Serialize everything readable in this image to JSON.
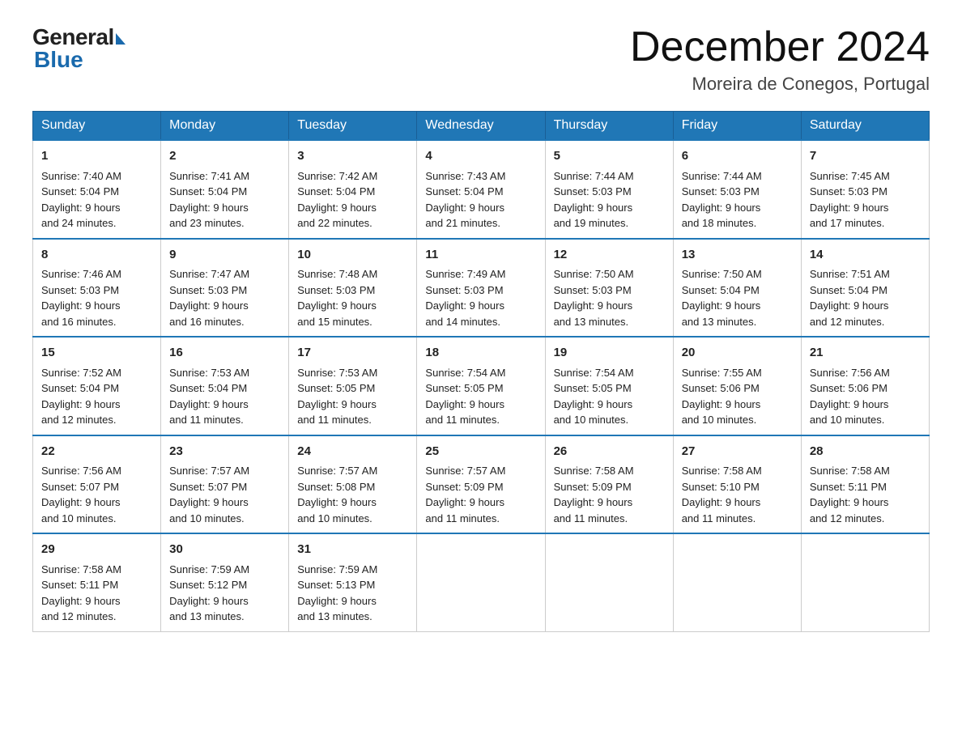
{
  "header": {
    "logo_general": "General",
    "logo_blue": "Blue",
    "month_title": "December 2024",
    "location": "Moreira de Conegos, Portugal"
  },
  "days_of_week": [
    "Sunday",
    "Monday",
    "Tuesday",
    "Wednesday",
    "Thursday",
    "Friday",
    "Saturday"
  ],
  "weeks": [
    [
      {
        "day": "1",
        "sunrise": "7:40 AM",
        "sunset": "5:04 PM",
        "daylight": "9 hours and 24 minutes."
      },
      {
        "day": "2",
        "sunrise": "7:41 AM",
        "sunset": "5:04 PM",
        "daylight": "9 hours and 23 minutes."
      },
      {
        "day": "3",
        "sunrise": "7:42 AM",
        "sunset": "5:04 PM",
        "daylight": "9 hours and 22 minutes."
      },
      {
        "day": "4",
        "sunrise": "7:43 AM",
        "sunset": "5:04 PM",
        "daylight": "9 hours and 21 minutes."
      },
      {
        "day": "5",
        "sunrise": "7:44 AM",
        "sunset": "5:03 PM",
        "daylight": "9 hours and 19 minutes."
      },
      {
        "day": "6",
        "sunrise": "7:44 AM",
        "sunset": "5:03 PM",
        "daylight": "9 hours and 18 minutes."
      },
      {
        "day": "7",
        "sunrise": "7:45 AM",
        "sunset": "5:03 PM",
        "daylight": "9 hours and 17 minutes."
      }
    ],
    [
      {
        "day": "8",
        "sunrise": "7:46 AM",
        "sunset": "5:03 PM",
        "daylight": "9 hours and 16 minutes."
      },
      {
        "day": "9",
        "sunrise": "7:47 AM",
        "sunset": "5:03 PM",
        "daylight": "9 hours and 16 minutes."
      },
      {
        "day": "10",
        "sunrise": "7:48 AM",
        "sunset": "5:03 PM",
        "daylight": "9 hours and 15 minutes."
      },
      {
        "day": "11",
        "sunrise": "7:49 AM",
        "sunset": "5:03 PM",
        "daylight": "9 hours and 14 minutes."
      },
      {
        "day": "12",
        "sunrise": "7:50 AM",
        "sunset": "5:03 PM",
        "daylight": "9 hours and 13 minutes."
      },
      {
        "day": "13",
        "sunrise": "7:50 AM",
        "sunset": "5:04 PM",
        "daylight": "9 hours and 13 minutes."
      },
      {
        "day": "14",
        "sunrise": "7:51 AM",
        "sunset": "5:04 PM",
        "daylight": "9 hours and 12 minutes."
      }
    ],
    [
      {
        "day": "15",
        "sunrise": "7:52 AM",
        "sunset": "5:04 PM",
        "daylight": "9 hours and 12 minutes."
      },
      {
        "day": "16",
        "sunrise": "7:53 AM",
        "sunset": "5:04 PM",
        "daylight": "9 hours and 11 minutes."
      },
      {
        "day": "17",
        "sunrise": "7:53 AM",
        "sunset": "5:05 PM",
        "daylight": "9 hours and 11 minutes."
      },
      {
        "day": "18",
        "sunrise": "7:54 AM",
        "sunset": "5:05 PM",
        "daylight": "9 hours and 11 minutes."
      },
      {
        "day": "19",
        "sunrise": "7:54 AM",
        "sunset": "5:05 PM",
        "daylight": "9 hours and 10 minutes."
      },
      {
        "day": "20",
        "sunrise": "7:55 AM",
        "sunset": "5:06 PM",
        "daylight": "9 hours and 10 minutes."
      },
      {
        "day": "21",
        "sunrise": "7:56 AM",
        "sunset": "5:06 PM",
        "daylight": "9 hours and 10 minutes."
      }
    ],
    [
      {
        "day": "22",
        "sunrise": "7:56 AM",
        "sunset": "5:07 PM",
        "daylight": "9 hours and 10 minutes."
      },
      {
        "day": "23",
        "sunrise": "7:57 AM",
        "sunset": "5:07 PM",
        "daylight": "9 hours and 10 minutes."
      },
      {
        "day": "24",
        "sunrise": "7:57 AM",
        "sunset": "5:08 PM",
        "daylight": "9 hours and 10 minutes."
      },
      {
        "day": "25",
        "sunrise": "7:57 AM",
        "sunset": "5:09 PM",
        "daylight": "9 hours and 11 minutes."
      },
      {
        "day": "26",
        "sunrise": "7:58 AM",
        "sunset": "5:09 PM",
        "daylight": "9 hours and 11 minutes."
      },
      {
        "day": "27",
        "sunrise": "7:58 AM",
        "sunset": "5:10 PM",
        "daylight": "9 hours and 11 minutes."
      },
      {
        "day": "28",
        "sunrise": "7:58 AM",
        "sunset": "5:11 PM",
        "daylight": "9 hours and 12 minutes."
      }
    ],
    [
      {
        "day": "29",
        "sunrise": "7:58 AM",
        "sunset": "5:11 PM",
        "daylight": "9 hours and 12 minutes."
      },
      {
        "day": "30",
        "sunrise": "7:59 AM",
        "sunset": "5:12 PM",
        "daylight": "9 hours and 13 minutes."
      },
      {
        "day": "31",
        "sunrise": "7:59 AM",
        "sunset": "5:13 PM",
        "daylight": "9 hours and 13 minutes."
      },
      null,
      null,
      null,
      null
    ]
  ],
  "labels": {
    "sunrise": "Sunrise:",
    "sunset": "Sunset:",
    "daylight": "Daylight:"
  }
}
